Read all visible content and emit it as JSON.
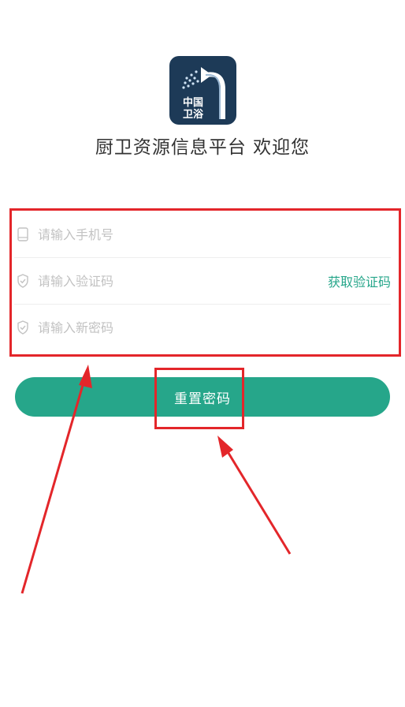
{
  "app": {
    "title": "厨卫资源信息平台 欢迎您",
    "logo_text_line1": "中国",
    "logo_text_line2": "卫浴"
  },
  "form": {
    "phone": {
      "placeholder": "请输入手机号",
      "icon": "phone-icon",
      "value": ""
    },
    "code": {
      "placeholder": "请输入验证码",
      "icon": "shield-check-icon",
      "value": "",
      "get_code_label": "获取验证码"
    },
    "new_password": {
      "placeholder": "请输入新密码",
      "icon": "shield-check-icon",
      "value": ""
    }
  },
  "actions": {
    "reset_label": "重置密码"
  },
  "colors": {
    "accent": "#26a68a",
    "logo_bg": "#1d3a57",
    "annotation_red": "#e3262a",
    "placeholder": "#c2c2c2"
  }
}
